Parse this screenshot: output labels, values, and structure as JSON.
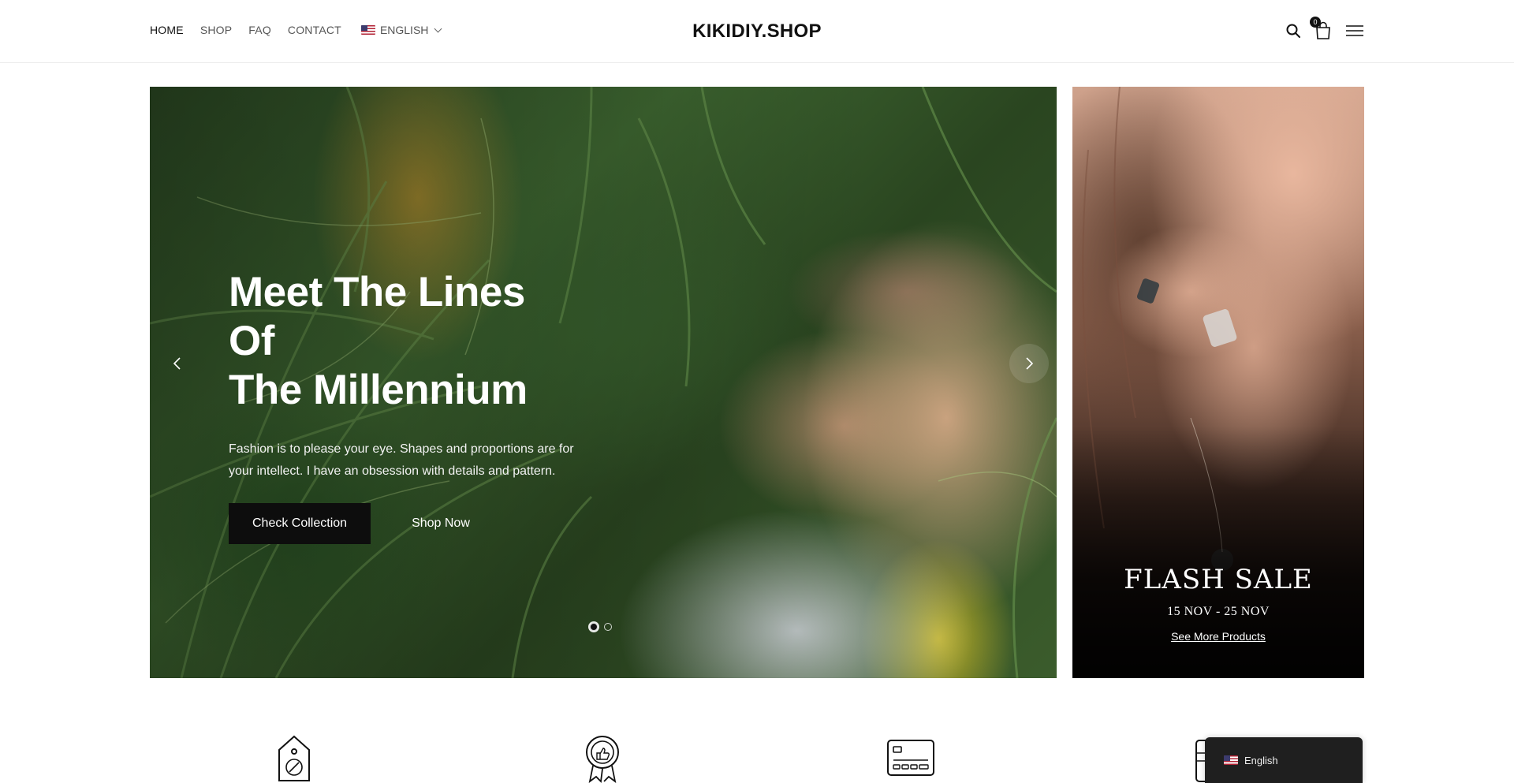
{
  "brand": {
    "logo": "KIKIDIY.SHOP"
  },
  "nav": {
    "items": [
      {
        "label": "HOME",
        "active": true
      },
      {
        "label": "SHOP"
      },
      {
        "label": "FAQ"
      },
      {
        "label": "CONTACT"
      }
    ],
    "language": {
      "label": "ENGLISH",
      "flag": "us-flag-icon"
    }
  },
  "header_icons": {
    "search": "search-icon",
    "cart": "shopping-bag-icon",
    "cart_count": "0",
    "menu": "hamburger-menu-icon"
  },
  "hero": {
    "title_line1": "Meet The Lines Of",
    "title_line2": "The Millennium",
    "text": "Fashion is to please your eye. Shapes and proportions are for your intellect. I have an obsession with details and pattern.",
    "primary_button": "Check Collection",
    "secondary_button": "Shop Now",
    "slides": 2,
    "active_slide": 1
  },
  "side_banner": {
    "title": "FLASH SALE",
    "dates": "15 NOV - 25 NOV",
    "link": "See More Products"
  },
  "features": [
    {
      "icon": "discount-tag-icon"
    },
    {
      "icon": "quality-badge-icon"
    },
    {
      "icon": "credit-card-icon"
    },
    {
      "icon": "document-icon"
    }
  ],
  "language_switcher": {
    "label": "English",
    "flag": "us-flag-icon"
  },
  "colors": {
    "text": "#111111",
    "button_dark": "#0d0d0d",
    "switcher_bg": "#1f1f1f"
  }
}
